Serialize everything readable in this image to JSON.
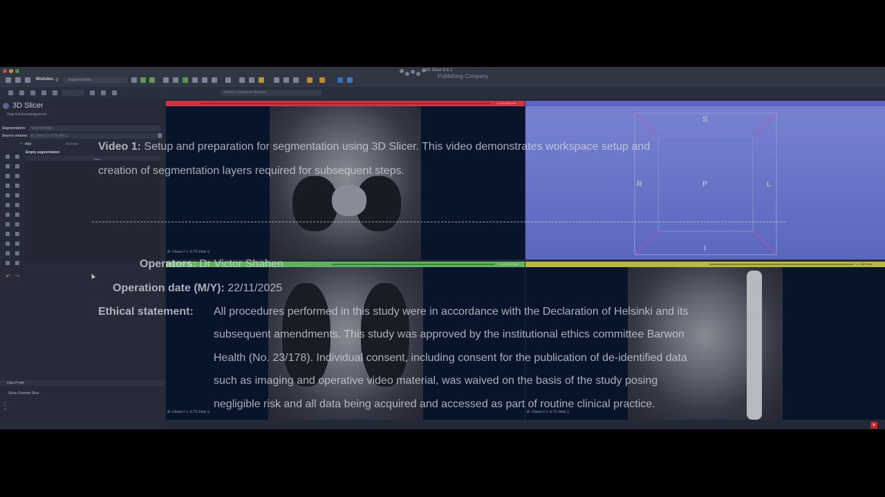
{
  "app": {
    "title": "3D Slicer 5.6.1",
    "publisher": "Publishing Company",
    "modules_label": "Modules:",
    "module_selected": "Segment Editor",
    "sequence_select": "Select a Sequence Browser"
  },
  "left_panel": {
    "title": "3D Slicer",
    "help_ack": "Help & Acknowledgement",
    "segmentation_label": "Segmentation:",
    "segmentation_value": "Segmentation",
    "source_volume_label": "Source volume:",
    "source_volume_value": "B: Chest C+ 0.75 I40s 2",
    "add_label": "Add",
    "remove_label": "Remove",
    "empty_segmentation": "Empty segmentation",
    "column_name": "Name",
    "data_probe": "Data Probe",
    "show_zoomed_slice": "Show Zoomed Slice",
    "probe_values": "L\nF\nB"
  },
  "views": {
    "red": {
      "color": "#e8414f",
      "offset": "S: 614.0000mm",
      "label": "B: Chest C+ 0.75 I40s 2"
    },
    "green": {
      "color": "#6fd16f",
      "offset": "A: 161.0000mm",
      "label": "B: Chest C+ 0.75 I40s 2"
    },
    "yellow": {
      "color": "#d8d84a",
      "offset": "L: 1.6971mm",
      "label": "B: Chest C+ 0.75 I40s 2"
    },
    "three_d": {
      "color": "#5d66e0",
      "axis_s": "S",
      "axis_r": "R",
      "axis_p": "P",
      "axis_l": "L",
      "axis_i": "I"
    }
  },
  "overlay": {
    "video_title": "Video 1:",
    "video_desc_1": "Setup and preparation for segmentation using 3D Slicer. This video demonstrates workspace setup and",
    "video_desc_2": "creation of segmentation layers required for subsequent steps.",
    "operators_label": "Operators:",
    "operators_value": "Dr Victor Shahen",
    "date_label": "Operation date (M/Y):",
    "date_value": "22/11/2025",
    "ethics_label": "Ethical statement:",
    "ethics_1": "All procedures performed in this study were in accordance with the Declaration of Helsinki and its",
    "ethics_2": "subsequent amendments. This study was approved by the institutional ethics committee Barwon",
    "ethics_3": "Health (No. 23/178). Individual consent, including consent for the publication of de-identified data",
    "ethics_4": "such as imaging and operative video material, was waived on the basis of the study posing",
    "ethics_5": "negligible risk and all data being acquired and accessed as part of routine clinical practice."
  }
}
